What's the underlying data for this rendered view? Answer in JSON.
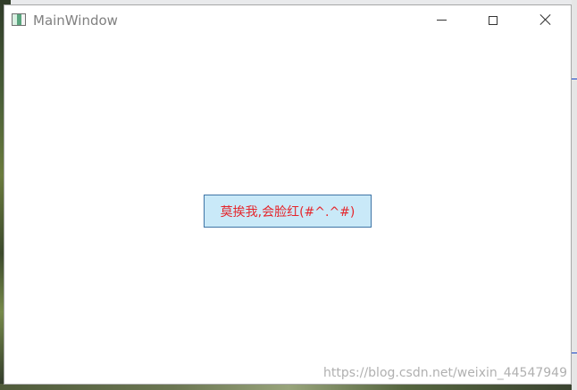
{
  "window": {
    "title": "MainWindow",
    "icon": "app-window-icon",
    "controls": {
      "minimize_icon": "minimize-icon",
      "maximize_icon": "maximize-icon",
      "close_icon": "close-icon"
    }
  },
  "main": {
    "shy_button_label": "莫挨我,会脸红(#^.^#)",
    "shy_button_text_color": "#e5262c",
    "shy_button_bg_color": "#c9e9f8",
    "shy_button_border_color": "#3e74a6"
  },
  "watermark": {
    "text": "https://blog.csdn.net/weixin_44547949"
  }
}
